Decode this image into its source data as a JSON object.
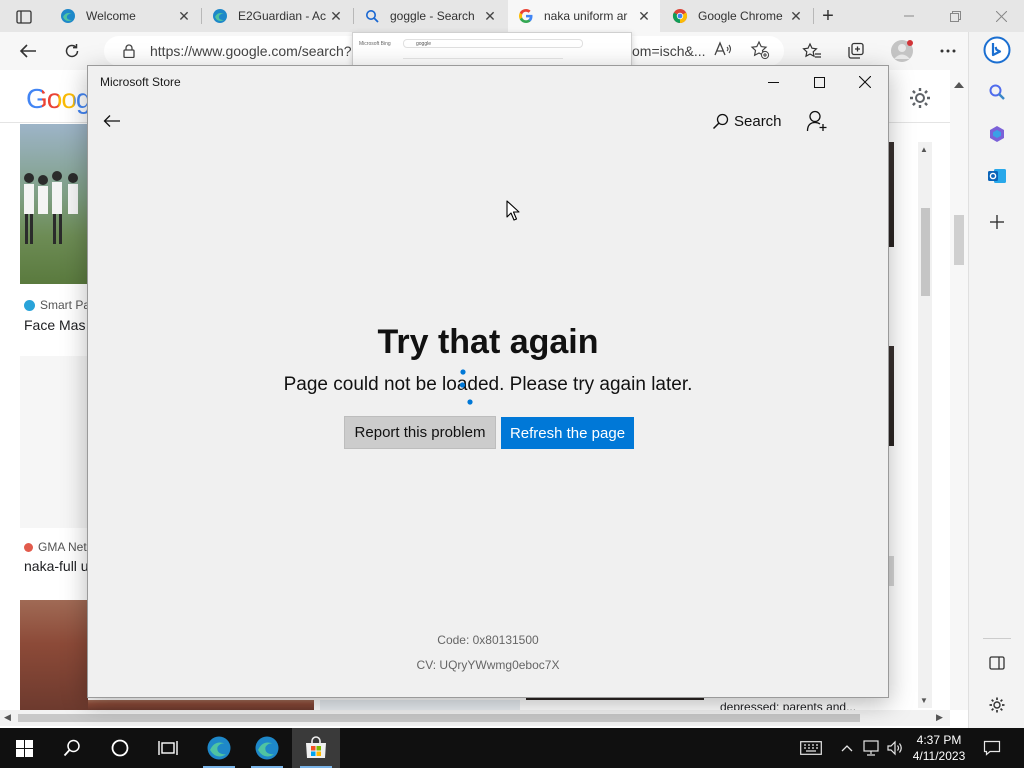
{
  "browser": {
    "tabs": [
      {
        "label": "Welcome",
        "icon": "edge-icon"
      },
      {
        "label": "E2Guardian - Ac",
        "icon": "edge-icon"
      },
      {
        "label": "goggle - Search",
        "icon": "search-icon"
      },
      {
        "label": "naka uniform ar",
        "icon": "google-icon"
      },
      {
        "label": "Google Chrome",
        "icon": "chrome-icon"
      }
    ],
    "active_tab_index": 3,
    "address": {
      "url_left": "https://www.google.com/search?c",
      "url_right": "om=isch&..."
    },
    "tab_preview": {
      "logo_text": "Microsoft Bing",
      "query": "goggle"
    }
  },
  "page_behind": {
    "logo": "Goog",
    "cards": [
      {
        "source": "Smart Pa",
        "caption": "Face Mas"
      },
      {
        "source": "GMA Net",
        "caption": "naka-full u"
      }
    ],
    "bottom_caption": "depressed: parents and..."
  },
  "store": {
    "window_title": "Microsoft Store",
    "search_label": "Search",
    "heading": "Try that again",
    "message": "Page could not be loaded. Please try again later.",
    "report_button": "Report this problem",
    "refresh_button": "Refresh the page",
    "error_code": "Code: 0x80131500",
    "cv": "CV: UQryYWwmg0eboc7X"
  },
  "taskbar": {
    "time": "4:37 PM",
    "date": "4/11/2023"
  },
  "colors": {
    "accent_blue": "#0078d7",
    "store_background": "#f0f0f0",
    "taskbar": "#101010"
  }
}
